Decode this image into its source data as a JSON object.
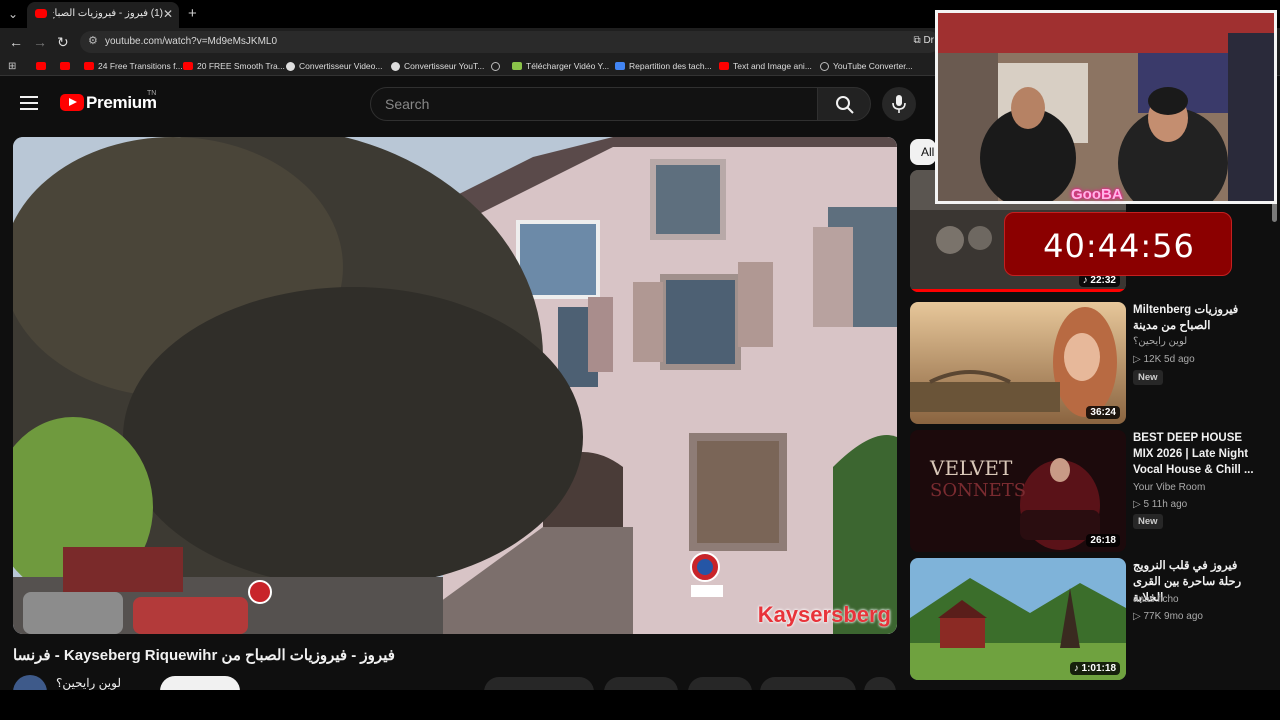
{
  "browser": {
    "tab_title": "(1) فيروز - فيروزيات الصباح م...",
    "url": "youtube.com/watch?v=Md9eMsJKML0",
    "extension_label": "Dr",
    "bookmarks": [
      {
        "label": "",
        "icon": "yt"
      },
      {
        "label": "",
        "icon": "yt"
      },
      {
        "label": "24 Free Transitions f...",
        "icon": "yt"
      },
      {
        "label": "20 FREE Smooth Tra...",
        "icon": "yt"
      },
      {
        "label": "Convertisseur Video...",
        "icon": "gr"
      },
      {
        "label": "Convertisseur YouT...",
        "icon": "gr"
      },
      {
        "label": "",
        "icon": "glob"
      },
      {
        "label": "Télécharger Vidéo Y...",
        "icon": "dl"
      },
      {
        "label": "Repartition des tach...",
        "icon": "doc"
      },
      {
        "label": "Text and Image ani...",
        "icon": "yt"
      },
      {
        "label": "YouTube Converter...",
        "icon": "glob"
      }
    ]
  },
  "header": {
    "logo_text": "Premium",
    "country_code": "TN",
    "search_placeholder": "Search"
  },
  "video": {
    "overlay_caption": "Kaysersberg",
    "title": "فيروز - فيروزيات الصباح من Kayseberg Riquewihr - فرنسا",
    "channel_name": "لوين رايحين؟"
  },
  "stream_overlay": {
    "webcam_label": "GooBA",
    "timer": "40:44:56"
  },
  "sidebar": {
    "chip_all": "All",
    "recommendations": [
      {
        "duration": "22:32",
        "duration_icon": "music-note",
        "title": "",
        "channel": "",
        "meta": ""
      },
      {
        "duration": "36:24",
        "title": "فيروزيات Miltenberg الصباح من مدينة",
        "channel": "لوين رايحين؟",
        "meta": "▷ 12K  5d ago",
        "badge": "New"
      },
      {
        "duration": "26:18",
        "title": "BEST DEEP HOUSE MIX 2026 | Late Night Vocal House & Chill ...",
        "channel": "Your Vibe Room",
        "meta": "▷ 5  11h ago",
        "badge": "New"
      },
      {
        "duration": "1:01:18",
        "duration_icon": "music-note",
        "title": "فيروز في قلب النرويج رحلة ساحرة بين القرى الخلابة",
        "channel": "anas ficho",
        "meta": "▷ 77K  9mo ago"
      }
    ]
  },
  "colors": {
    "brand_red": "#ff0000",
    "timer_bg": "#8b0000",
    "page_bg": "#0f0f0f"
  }
}
